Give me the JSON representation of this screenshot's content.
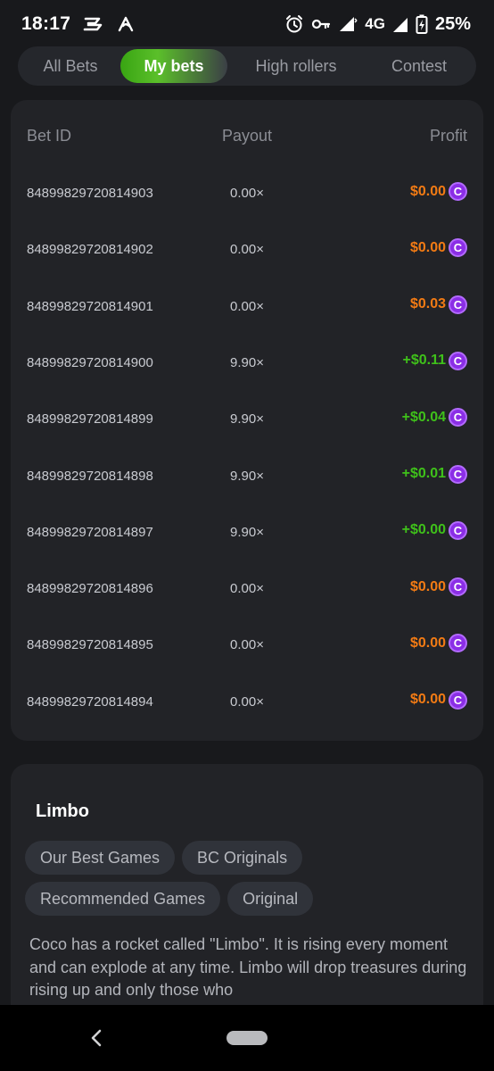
{
  "status_bar": {
    "time": "18:17",
    "network": "4G",
    "battery": "25%",
    "icons": [
      "app-notification-icon",
      "swipe-app-icon",
      "alarm-icon",
      "vpn-key-icon",
      "wifi-signal-icon",
      "cell-signal-icon",
      "battery-charging-icon"
    ]
  },
  "tabs": [
    {
      "label": "All Bets",
      "active": false
    },
    {
      "label": "My bets",
      "active": true
    },
    {
      "label": "High rollers",
      "active": false
    },
    {
      "label": "Contest",
      "active": false
    }
  ],
  "bets_table": {
    "headers": {
      "bet_id": "Bet ID",
      "payout": "Payout",
      "profit": "Profit"
    },
    "rows": [
      {
        "bet_id": "84899829720814903",
        "payout": "0.00×",
        "profit": "$0.00",
        "win": false
      },
      {
        "bet_id": "84899829720814902",
        "payout": "0.00×",
        "profit": "$0.00",
        "win": false
      },
      {
        "bet_id": "84899829720814901",
        "payout": "0.00×",
        "profit": "$0.03",
        "win": false
      },
      {
        "bet_id": "84899829720814900",
        "payout": "9.90×",
        "profit": "+$0.11",
        "win": true
      },
      {
        "bet_id": "84899829720814899",
        "payout": "9.90×",
        "profit": "+$0.04",
        "win": true
      },
      {
        "bet_id": "84899829720814898",
        "payout": "9.90×",
        "profit": "+$0.01",
        "win": true
      },
      {
        "bet_id": "84899829720814897",
        "payout": "9.90×",
        "profit": "+$0.00",
        "win": true
      },
      {
        "bet_id": "84899829720814896",
        "payout": "0.00×",
        "profit": "$0.00",
        "win": false
      },
      {
        "bet_id": "84899829720814895",
        "payout": "0.00×",
        "profit": "$0.00",
        "win": false
      },
      {
        "bet_id": "84899829720814894",
        "payout": "0.00×",
        "profit": "$0.00",
        "win": false
      }
    ],
    "currency_icon": "bc-coin-icon",
    "currency_glyph": "C"
  },
  "game_info": {
    "title": "Limbo",
    "tags": [
      "Our Best Games",
      "BC Originals",
      "Recommended Games",
      "Original"
    ],
    "description": "Coco has a rocket called \"Limbo\". It is rising every moment and can explode at any time. Limbo will drop treasures during rising up and only those who"
  },
  "colors": {
    "win": "#3fc11a",
    "loss": "#f37b14",
    "active_tab": "#39a513",
    "coin": "#8b2ee6"
  }
}
